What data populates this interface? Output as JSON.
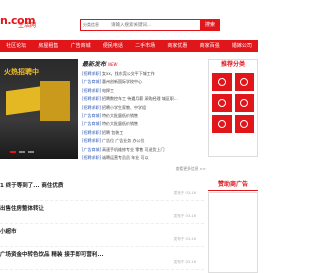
{
  "header": {
    "logo": "n.com",
    "logo_sub": "生活网",
    "search_select": "分类信息",
    "search_placeholder": "请输入搜索关键词...",
    "search_button": "搜索"
  },
  "nav": [
    "社区论坛",
    "房屋租售",
    "广告商城",
    "便民电话",
    "二手市场",
    "商家优惠",
    "商家百强",
    "婚嫁公司"
  ],
  "slider": {
    "caption": "火热招聘中"
  },
  "news": {
    "title": "最新发布",
    "subtitle": "NEW",
    "rows": [
      {
        "cat": "[招聘求职]",
        "text": "女xx，找东莞公交平下城工作"
      },
      {
        "cat": "[广告商城]",
        "text": "惠州创新国际学校中心"
      },
      {
        "cat": "[招聘求职]",
        "text": "电焊工"
      },
      {
        "cat": "[招聘求职]",
        "text": "招聘数控车工 待遇月薪 采购经理 城区职..."
      },
      {
        "cat": "[招聘求职]",
        "text": "招聘小学生家教、中学组"
      },
      {
        "cat": "[广告商城]",
        "text": "特价大批量低价销售"
      },
      {
        "cat": "[广告商城]",
        "text": "特价大批量低价销售"
      },
      {
        "cat": "[招聘求职]",
        "text": "招聘 包装工"
      },
      {
        "cat": "[招聘求职]",
        "text": "广告位 广告业务 办公位"
      },
      {
        "cat": "[广告商城]",
        "text": "高速手机维修专业 零售 可送货上门"
      },
      {
        "cat": "[招聘求职]",
        "text": "诚聘运营专员员 年业 可以"
      }
    ],
    "more": "查看更多信息 >>"
  },
  "side": {
    "title": "推荐分类",
    "title2": "赞助商广告"
  },
  "feed": [
    {
      "title": "1 终于等到了... 商住优质",
      "date": "发布于 03-16"
    },
    {
      "title": "出售住房整体转让",
      "date": "发布于 03-16"
    },
    {
      "title": "小超市",
      "date": "发布于 03-16"
    },
    {
      "title": "广场资金中转色饮品 精装 接手即可营利...",
      "date": "发布于 03-16"
    }
  ]
}
